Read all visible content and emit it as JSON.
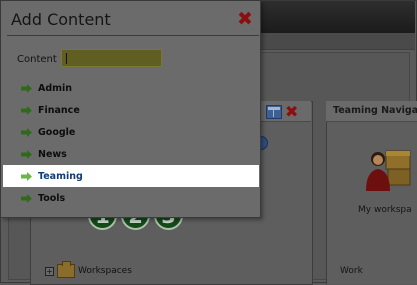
{
  "dialog": {
    "title": "Add Content",
    "content_label": "Content",
    "content_value": "",
    "items": [
      {
        "label": "Admin"
      },
      {
        "label": "Finance"
      },
      {
        "label": "Google"
      },
      {
        "label": "News"
      },
      {
        "label": "Teaming",
        "selected": true
      },
      {
        "label": "Tools"
      }
    ]
  },
  "background": {
    "right_panel_title": "Teaming Navigat",
    "my_workspace_label": "My workspa",
    "right_bottom_label": "Work",
    "tree_label": "Workspaces",
    "steps": [
      "1",
      "2",
      "3"
    ]
  },
  "colors": {
    "arrow_green": "#2f6a1c",
    "selected_arrow": "#6db544",
    "close_red": "#8a0f0f"
  }
}
